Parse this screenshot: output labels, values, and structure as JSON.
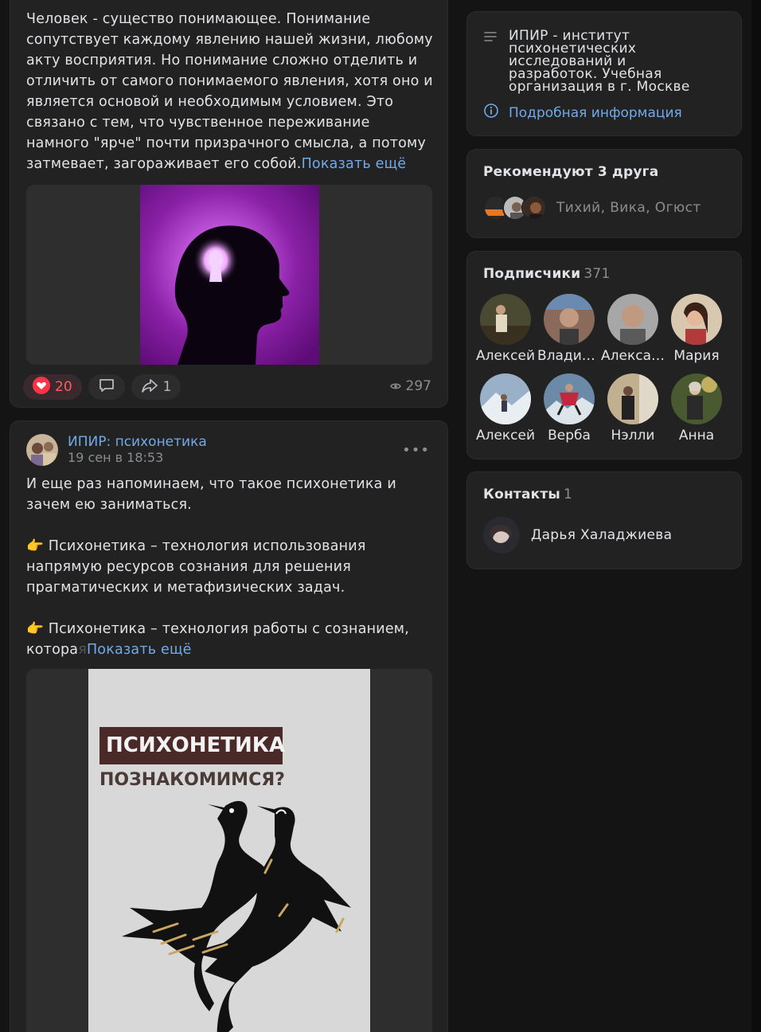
{
  "post1": {
    "text": "Человек - существо понимающее. Понимание сопутствует каждому явлению нашей жизни, любому акту восприятия. Но понимание сложно отделить и отличить от самого понимаемого явления, хотя оно и является основой и необходимым условием. Это связано с тем, что чувственное переживание намного \"ярче\" почти призрачного смысла, а потому затмевает, загораживает его собой.",
    "show_more": "Показать ещё",
    "likes": "20",
    "reposts": "1",
    "views": "297"
  },
  "post2": {
    "author": "ИПИР: психонетика",
    "date": "19 сен в 18:53",
    "menu": "•••",
    "para1": "И еще раз напоминаем, что такое психонетика и зачем ею заниматься.",
    "para2": "👉 Психонетика – технология использования напрямую ресурсов сознания для решения прагматических и метафизических задач.",
    "para3": "👉 Психонетика – технология работы с сознанием, котора",
    "para3_fade": "я",
    "show_more": "Показать ещё",
    "poster_title": "ПСИХОНЕТИКА",
    "poster_subtitle": "ПОЗНАКОМИМСЯ?"
  },
  "sidebar": {
    "info_text": "ИПИР - институт психонетических исследований и разработок. Учебная организация в г. Москве",
    "info_link": "Подробная информация",
    "recs_title": "Рекомендуют 3 друга",
    "recs_names": "Тихий, Вика, Огюст",
    "subs_title": "Подписчики",
    "subs_count": "371",
    "subscribers": [
      {
        "name": "Алексей"
      },
      {
        "name": "Владимир"
      },
      {
        "name": "Александр"
      },
      {
        "name": "Мария"
      },
      {
        "name": "Алексей"
      },
      {
        "name": "Верба"
      },
      {
        "name": "Нэлли"
      },
      {
        "name": "Анна"
      }
    ],
    "contacts_title": "Контакты",
    "contacts_count": "1",
    "contact_name": "Дарья Халаджиева"
  },
  "colors": {
    "background": "#141414",
    "card": "#222222",
    "link": "#71aaeb",
    "like": "#ff3347"
  }
}
